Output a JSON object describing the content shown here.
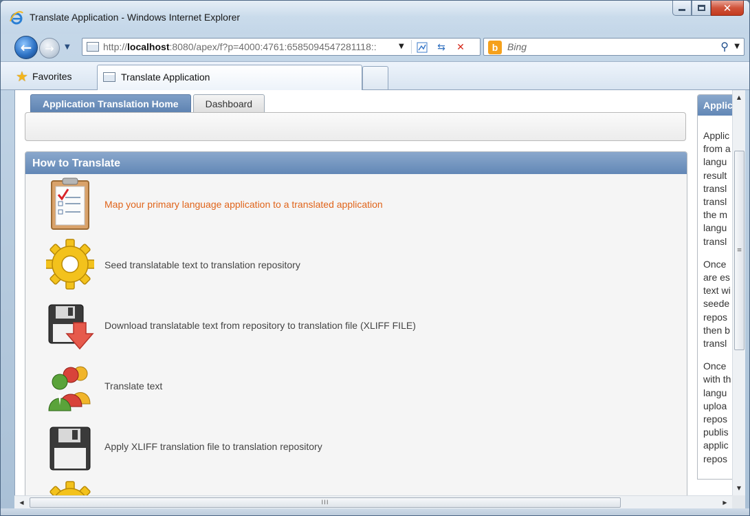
{
  "window": {
    "title": "Translate Application - Windows Internet Explorer"
  },
  "address_bar": {
    "url_prefix": "http://",
    "url_host": "localhost",
    "url_rest": ":8080/apex/f?p=4000:4761:6585094547281118::"
  },
  "search": {
    "placeholder": "Bing"
  },
  "favorites": {
    "label": "Favorites"
  },
  "browser_tabs": [
    {
      "label": "Translate Application"
    }
  ],
  "app_tabs": [
    {
      "label": "Application Translation Home",
      "active": true
    },
    {
      "label": "Dashboard",
      "active": false
    }
  ],
  "how_to": {
    "heading": "How to Translate",
    "steps": [
      {
        "icon": "clipboard-checklist-icon",
        "text": "Map your primary language application to a translated application",
        "is_link": true
      },
      {
        "icon": "gear-icon",
        "text": "Seed translatable text to translation repository",
        "is_link": false
      },
      {
        "icon": "floppy-download-icon",
        "text": "Download translatable text from repository to translation file (XLIFF FILE)",
        "is_link": false
      },
      {
        "icon": "people-group-icon",
        "text": "Translate text",
        "is_link": false
      },
      {
        "icon": "floppy-disk-icon",
        "text": "Apply XLIFF translation file to translation repository",
        "is_link": false
      }
    ]
  },
  "side_panel": {
    "heading": "Applic",
    "paragraphs": [
      [
        "Applic",
        "from a",
        "langu",
        "result",
        "transl",
        "transl",
        "the m",
        "langu",
        "transl"
      ],
      [
        "Once",
        "are es",
        "text wi",
        "seede",
        "repos",
        "then b",
        "transl"
      ],
      [
        "Once",
        "with th",
        "langu",
        "uploa",
        "repos",
        "publis",
        "applic",
        "repos"
      ]
    ]
  },
  "scrollbars": {
    "grip_vertical": "≡",
    "grip_horizontal": "III"
  },
  "colors": {
    "region_header": "#6f93c0",
    "link_orange": "#e0641a"
  }
}
